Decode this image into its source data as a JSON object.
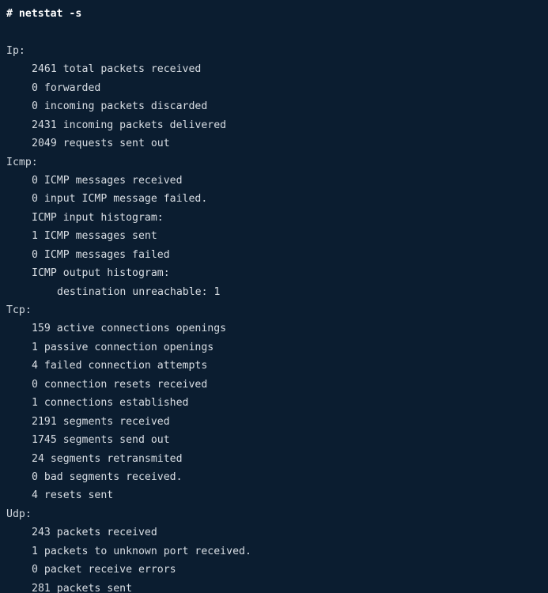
{
  "terminal": {
    "background_color": "#0b1d30",
    "text_color": "#d9dee4",
    "prompt_color": "#ffffff",
    "command_line": "# netstat -s",
    "blank_line": "",
    "sections": [
      {
        "label": "Ip:",
        "lines": [
          "2461 total packets received",
          "0 forwarded",
          "0 incoming packets discarded",
          "2431 incoming packets delivered",
          "2049 requests sent out"
        ]
      },
      {
        "label": "Icmp:",
        "lines": [
          "0 ICMP messages received",
          "0 input ICMP message failed.",
          "ICMP input histogram:",
          "1 ICMP messages sent",
          "0 ICMP messages failed",
          "ICMP output histogram:"
        ],
        "subline": "destination unreachable: 1"
      },
      {
        "label": "Tcp:",
        "lines": [
          "159 active connections openings",
          "1 passive connection openings",
          "4 failed connection attempts",
          "0 connection resets received",
          "1 connections established",
          "2191 segments received",
          "1745 segments send out",
          "24 segments retransmited",
          "0 bad segments received.",
          "4 resets sent"
        ]
      },
      {
        "label": "Udp:",
        "lines": [
          "243 packets received",
          "1 packets to unknown port received.",
          "0 packet receive errors",
          "281 packets sent"
        ]
      }
    ]
  }
}
